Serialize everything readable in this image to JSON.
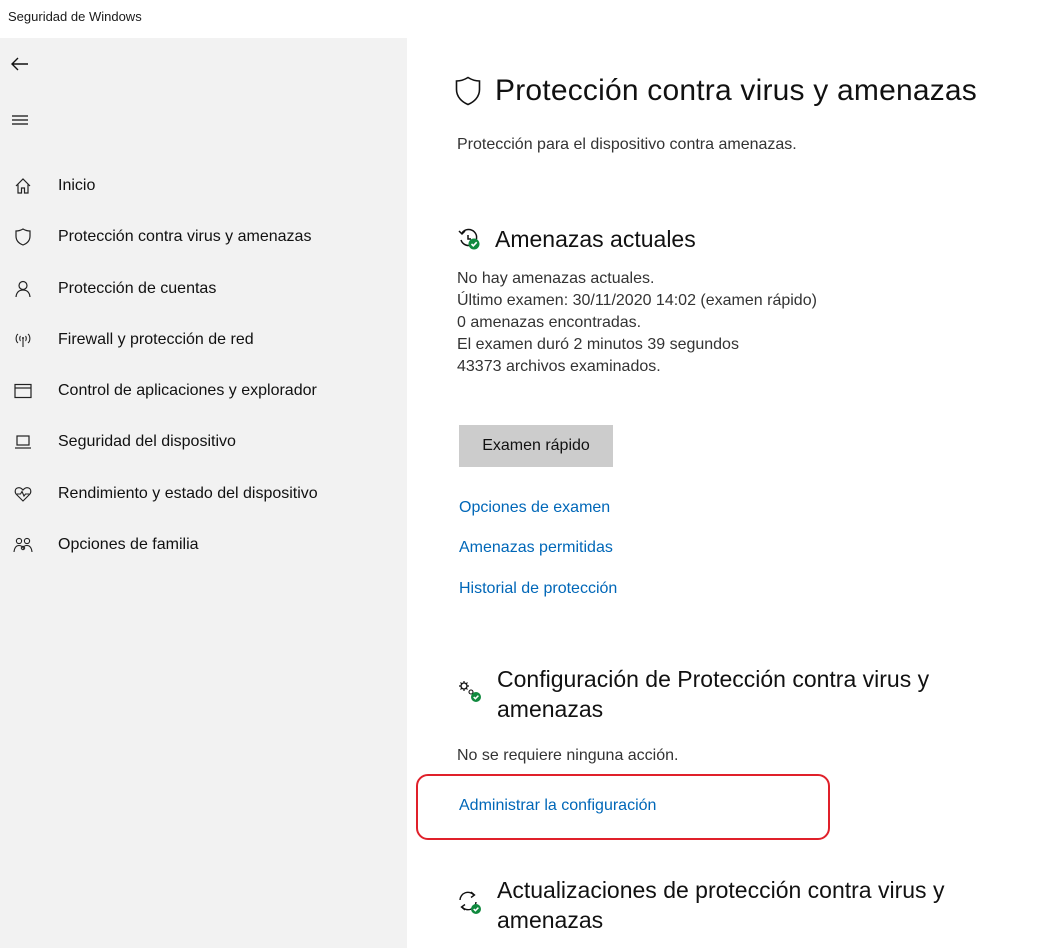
{
  "window": {
    "title": "Seguridad de Windows"
  },
  "sidebar": {
    "items": [
      {
        "label": "Inicio",
        "icon": "home-icon"
      },
      {
        "label": "Protección contra virus y amenazas",
        "icon": "shield-icon"
      },
      {
        "label": "Protección de cuentas",
        "icon": "person-icon"
      },
      {
        "label": "Firewall y protección de red",
        "icon": "wifi-signal-icon"
      },
      {
        "label": "Control de aplicaciones y explorador",
        "icon": "browser-window-icon"
      },
      {
        "label": "Seguridad del dispositivo",
        "icon": "laptop-icon"
      },
      {
        "label": "Rendimiento y estado del dispositivo",
        "icon": "heart-pulse-icon"
      },
      {
        "label": "Opciones de familia",
        "icon": "family-icon"
      }
    ]
  },
  "main": {
    "title": "Protección contra virus y amenazas",
    "subtitle": "Protección para el dispositivo contra amenazas.",
    "current_threats": {
      "heading": "Amenazas actuales",
      "lines": [
        "No hay amenazas actuales.",
        "Último examen: 30/11/2020 14:02 (examen rápido)",
        "0 amenazas encontradas.",
        "El examen duró 2 minutos 39 segundos",
        "43373 archivos examinados."
      ],
      "quick_scan_label": "Examen rápido",
      "links": [
        "Opciones de examen",
        "Amenazas permitidas",
        "Historial de protección"
      ]
    },
    "settings": {
      "heading_line1": "Configuración de Protección contra virus y",
      "heading_line2": "amenazas",
      "status": "No se requiere ninguna acción.",
      "link": "Administrar la configuración"
    },
    "updates": {
      "heading_line1": "Actualizaciones de protección contra virus y",
      "heading_line2": "amenazas"
    }
  },
  "colors": {
    "link": "#0067b8",
    "highlight": "#e0202a",
    "status_ok": "#10893e",
    "sidebar_bg": "#f2f2f2"
  }
}
